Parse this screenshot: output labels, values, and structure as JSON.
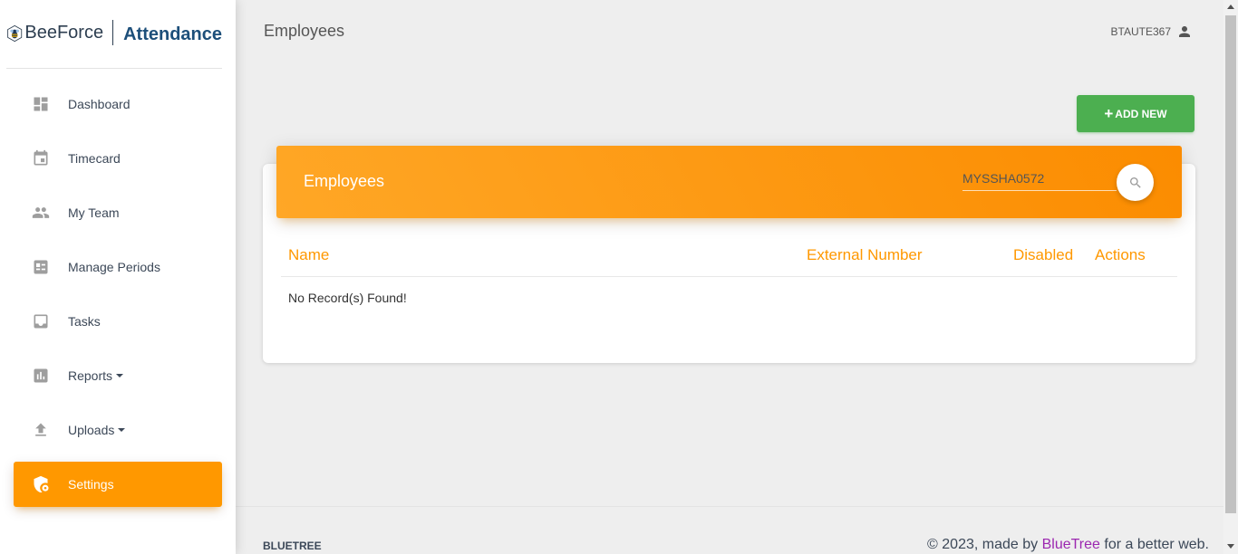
{
  "brand": {
    "name": "BeeForce",
    "product": "Attendance"
  },
  "sidebar": {
    "items": [
      {
        "label": "Dashboard",
        "icon": "dashboard-icon",
        "dropdown": false,
        "active": false
      },
      {
        "label": "Timecard",
        "icon": "calendar-icon",
        "dropdown": false,
        "active": false
      },
      {
        "label": "My Team",
        "icon": "people-icon",
        "dropdown": false,
        "active": false
      },
      {
        "label": "Manage Periods",
        "icon": "list-icon",
        "dropdown": false,
        "active": false
      },
      {
        "label": "Tasks",
        "icon": "inbox-icon",
        "dropdown": false,
        "active": false
      },
      {
        "label": "Reports",
        "icon": "bar-chart-icon",
        "dropdown": true,
        "active": false
      },
      {
        "label": "Uploads",
        "icon": "upload-icon",
        "dropdown": true,
        "active": false
      },
      {
        "label": "Settings",
        "icon": "shield-settings-icon",
        "dropdown": false,
        "active": true
      }
    ]
  },
  "header": {
    "title": "Employees",
    "user": "BTAUTE367"
  },
  "toolbar": {
    "add_label": "ADD NEW"
  },
  "card": {
    "title": "Employees",
    "search_value": "MYSSHA0572",
    "columns": [
      "Name",
      "External Number",
      "Disabled",
      "Actions"
    ],
    "empty_message": "No Record(s) Found!"
  },
  "footer": {
    "left": "BLUETREE",
    "copyright_prefix": "© 2023, made by",
    "link": "BlueTree",
    "copyright_suffix": "for a better web."
  },
  "colors": {
    "accent": "#ff9800",
    "success": "#4caf50",
    "link": "#9c27b0"
  }
}
